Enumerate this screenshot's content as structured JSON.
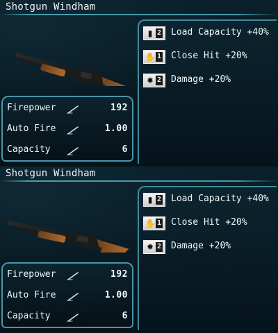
{
  "cards": [
    {
      "title": "Shotgun Windham",
      "stats": [
        {
          "label": "Firepower",
          "value": "192"
        },
        {
          "label": "Auto Fire",
          "value": "1.00"
        },
        {
          "label": "Capacity",
          "value": "6"
        }
      ],
      "mods": [
        {
          "icon": "load-capacity-icon",
          "level": "2",
          "text": "Load Capacity +40%"
        },
        {
          "icon": "close-hit-icon",
          "level": "1",
          "text": "Close Hit +20%"
        },
        {
          "icon": "damage-icon",
          "level": "2",
          "text": "Damage +20%"
        }
      ]
    },
    {
      "title": "Shotgun Windham",
      "stats": [
        {
          "label": "Firepower",
          "value": "192"
        },
        {
          "label": "Auto Fire",
          "value": "1.00"
        },
        {
          "label": "Capacity",
          "value": "6"
        }
      ],
      "mods": [
        {
          "icon": "load-capacity-icon",
          "level": "2",
          "text": "Load Capacity +40%"
        },
        {
          "icon": "close-hit-icon",
          "level": "1",
          "text": "Close Hit +20%"
        },
        {
          "icon": "damage-icon",
          "level": "2",
          "text": "Damage +20%"
        }
      ]
    }
  ],
  "theme": {
    "background": "#081a22",
    "accent": "#54aec4",
    "text": "#e9f2f5"
  }
}
